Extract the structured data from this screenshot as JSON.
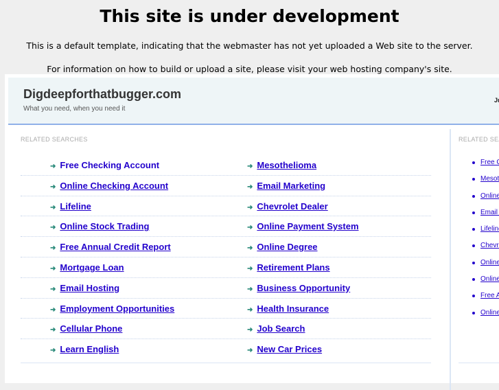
{
  "notice": {
    "title": "This site is under development",
    "line1": "This is a default template, indicating that the webmaster has not yet uploaded a Web site to the server.",
    "line2": "For information on how to build or upload a site, please visit your web hosting company's site."
  },
  "site": {
    "title": "Digdeepforthatbugger.com",
    "tagline": "What you need, when you need it",
    "date": "Ju"
  },
  "main": {
    "heading": "RELATED SEARCHES",
    "rows": [
      [
        "Free Checking Account",
        "Mesothelioma"
      ],
      [
        "Online Checking Account",
        "Email Marketing"
      ],
      [
        "Lifeline",
        "Chevrolet Dealer"
      ],
      [
        "Online Stock Trading",
        "Online Payment System"
      ],
      [
        "Free Annual Credit Report",
        "Online Degree"
      ],
      [
        "Mortgage Loan",
        "Retirement Plans"
      ],
      [
        "Email Hosting",
        "Business Opportunity"
      ],
      [
        "Employment Opportunities",
        "Health Insurance"
      ],
      [
        "Cellular Phone",
        "Job Search"
      ],
      [
        "Learn English",
        "New Car Prices"
      ]
    ]
  },
  "side": {
    "heading": "RELATED SEARCHES",
    "items": [
      "Free Checking Account",
      "Mesothelioma",
      "Online Checking Account",
      "Email Marketing",
      "Lifeline",
      "Chevrolet Dealer",
      "Online Stock Trading",
      "Online Payment System",
      "Free Annual Credit Report",
      "Online Degree"
    ]
  }
}
